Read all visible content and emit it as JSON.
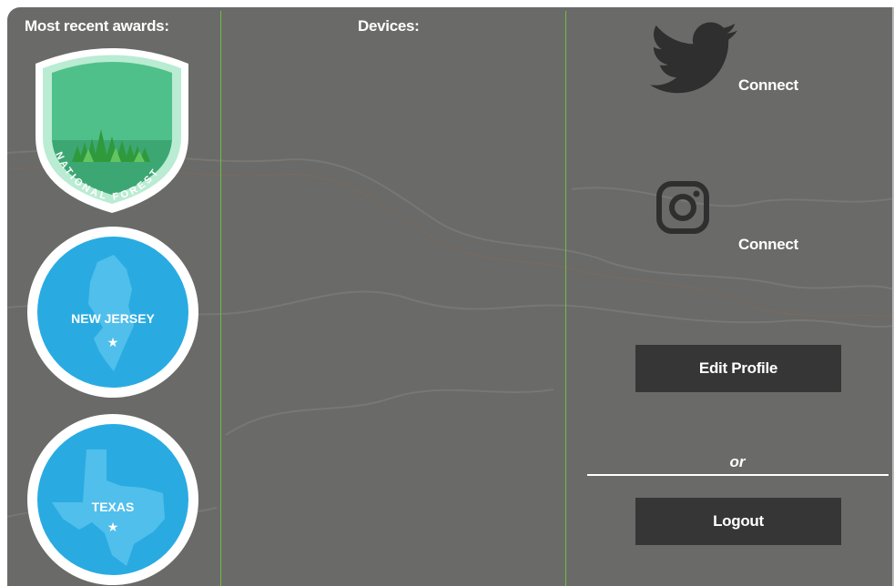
{
  "awards": {
    "heading": "Most recent awards:",
    "items": [
      {
        "name": "national-forest",
        "text": "NATIONAL FOREST",
        "color": "#4fc08a"
      },
      {
        "name": "new-jersey",
        "text": "NEW JERSEY",
        "color": "#29abe2"
      },
      {
        "name": "texas",
        "text": "TEXAS",
        "color": "#29abe2"
      }
    ]
  },
  "devices": {
    "heading": "Devices:"
  },
  "social": {
    "twitter": {
      "icon": "twitter-bird-icon",
      "label": "Connect"
    },
    "instagram": {
      "icon": "instagram-icon",
      "label": "Connect"
    }
  },
  "actions": {
    "edit_profile": "Edit Profile",
    "separator": "or",
    "logout": "Logout"
  },
  "colors": {
    "background": "#6a6a68",
    "column_divider": "#6fbf3f",
    "button": "#363636",
    "badge_blue": "#29abe2",
    "badge_green": "#4fc08a"
  }
}
